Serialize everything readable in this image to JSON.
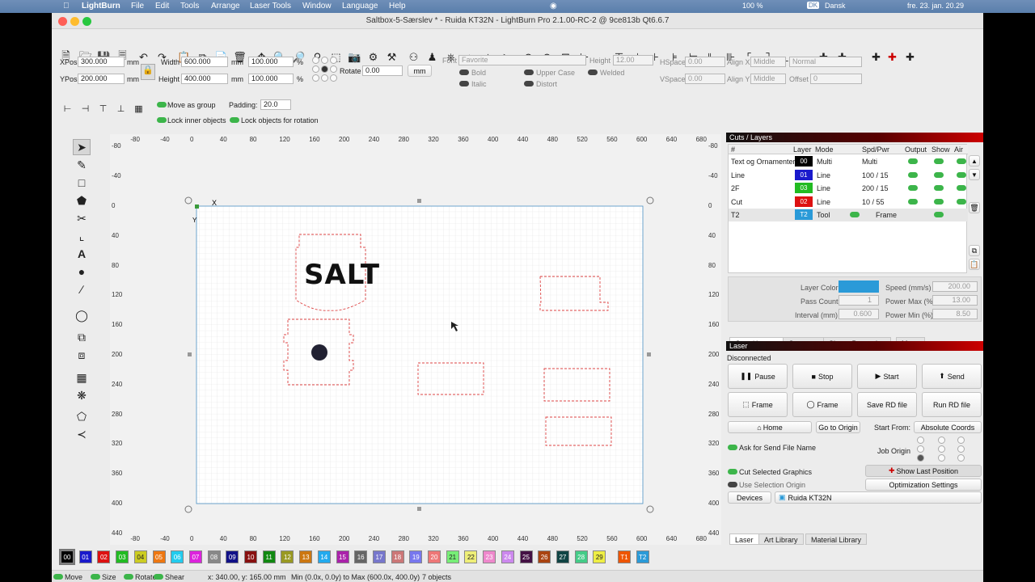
{
  "mac_menu": {
    "app": "LightBurn",
    "items": [
      "File",
      "Edit",
      "Tools",
      "Arrange",
      "Laser Tools",
      "Window",
      "Language",
      "Help"
    ],
    "battery": "100 %",
    "keyboard_badge": "DK",
    "language": "Dansk",
    "datetime": "fre. 23. jan. 20.29"
  },
  "window_title": "Saltbox-5-Særslev * - Ruida KT32N - LightBurn Pro 2.1.00-RC-2 @ 9ce813b Qt6.6.7",
  "numeric_edits": {
    "xpos_label": "XPos",
    "xpos": "300.000",
    "ypos_label": "YPos",
    "ypos": "200.000",
    "width_label": "Width",
    "width": "600.000",
    "height_label": "Height",
    "height": "400.000",
    "unit": "mm",
    "wpct": "100.000",
    "hpct": "100.000",
    "pct": "%",
    "rotate_label": "Rotate",
    "rotate": "0.00",
    "unit_button": "mm"
  },
  "font_bar": {
    "font_label": "Font",
    "font": "Favorite",
    "height_label": "Height",
    "height": "12.00",
    "hspace_label": "HSpace",
    "hspace": "0.00",
    "vspace_label": "VSpace",
    "vspace": "0.00",
    "alignx_label": "Align X",
    "alignx": "Middle",
    "aligny_label": "Align Y",
    "aligny": "Middle",
    "mode": "Normal",
    "offset_label": "Offset",
    "offset": "0",
    "bold": "Bold",
    "italic": "Italic",
    "upper": "Upper Case",
    "distort": "Distort",
    "welded": "Welded"
  },
  "group_bar": {
    "move_as_group": "Move as group",
    "padding_label": "Padding:",
    "padding": "20.0",
    "lock_inner": "Lock inner objects",
    "lock_rotation": "Lock objects for rotation"
  },
  "rulers": {
    "top": [
      "-80",
      "-40",
      "0",
      "40",
      "80",
      "120",
      "160",
      "200",
      "240",
      "280",
      "320",
      "360",
      "400",
      "440",
      "480",
      "520",
      "560",
      "600",
      "640",
      "680"
    ],
    "left": [
      "-80",
      "-40",
      "0",
      "40",
      "80",
      "120",
      "160",
      "200",
      "240",
      "280",
      "320",
      "360",
      "400",
      "440"
    ]
  },
  "canvas": {
    "axis_x": "X",
    "axis_y": "Y",
    "salt_text": "SALT"
  },
  "cuts_layers": {
    "title": "Cuts / Layers",
    "columns": [
      "#",
      "Layer",
      "Mode",
      "Spd/Pwr",
      "Output",
      "Show",
      "Air"
    ],
    "rows": [
      {
        "name": "Text og Ornamenter",
        "layer": "00",
        "color": "#000000",
        "mode": "Multi",
        "spd": "Multi"
      },
      {
        "name": "Line",
        "layer": "01",
        "color": "#1a1acc",
        "mode": "Line",
        "spd": "100 / 15"
      },
      {
        "name": "2F",
        "layer": "03",
        "color": "#22bb22",
        "mode": "Line",
        "spd": "200 / 15"
      },
      {
        "name": "Cut",
        "layer": "02",
        "color": "#dd1111",
        "mode": "Line",
        "spd": "10 / 55"
      },
      {
        "name": "T2",
        "layer": "T2",
        "color": "#2a9ad8",
        "mode": "Tool",
        "spd": "Frame"
      }
    ],
    "layer_color_label": "Layer Color",
    "speed_label": "Speed (mm/s)",
    "speed": "200.00",
    "pass_label": "Pass Count",
    "pass": "1",
    "pmax_label": "Power Max (%)",
    "pmax": "13.00",
    "interval_label": "Interval (mm)",
    "interval": "0.600",
    "pmin_label": "Power Min (%)",
    "pmin": "8.50",
    "tabs": [
      "Cuts / Layers",
      "Cameras",
      "Shape Properties",
      "Move"
    ]
  },
  "laser": {
    "title": "Laser",
    "status": "Disconnected",
    "pause": "Pause",
    "stop": "Stop",
    "start": "Start",
    "send": "Send",
    "frame1": "Frame",
    "frame2": "Frame",
    "save_rd": "Save RD file",
    "run_rd": "Run RD file",
    "home": "Home",
    "go_origin": "Go to Origin",
    "start_from_label": "Start From:",
    "start_from": "Absolute Coords",
    "ask_name": "Ask for Send File Name",
    "job_origin": "Job Origin",
    "cut_selected": "Cut Selected Graphics",
    "use_origin": "Use Selection Origin",
    "show_last": "Show Last Position",
    "optimization": "Optimization Settings",
    "devices": "Devices",
    "device": "Ruida KT32N",
    "tabs": [
      "Laser",
      "Art Library",
      "Material Library"
    ]
  },
  "palette": [
    "00",
    "01",
    "02",
    "03",
    "04",
    "05",
    "06",
    "07",
    "08",
    "09",
    "10",
    "11",
    "12",
    "13",
    "14",
    "15",
    "16",
    "17",
    "18",
    "19",
    "20",
    "21",
    "22",
    "23",
    "24",
    "25",
    "26",
    "27",
    "28",
    "29",
    "T1",
    "T2"
  ],
  "palette_colors": [
    "#000",
    "#1a1acc",
    "#dd1111",
    "#22bb22",
    "#cccc22",
    "#ee7711",
    "#22ccee",
    "#dd22dd",
    "#888",
    "#111188",
    "#881111",
    "#118811",
    "#999922",
    "#cc7711",
    "#22aaee",
    "#aa22aa",
    "#666",
    "#7777cc",
    "#cc7777",
    "#7777ee",
    "#ee7777",
    "#77ee77",
    "#eeee77",
    "#ee88cc",
    "#cc88ee",
    "#441144",
    "#aa4411",
    "#114444",
    "#44cc88",
    "#eeee44",
    "#ee5500",
    "#2a9ad8"
  ],
  "status": {
    "move": "Move",
    "size": "Size",
    "rotate": "Rotate",
    "shear": "Shear",
    "coords": "x: 340.00, y: 165.00 mm",
    "bounds": "Min (0.0x, 0.0y) to Max (600.0x, 400.0y)",
    "objects": "7 objects"
  }
}
